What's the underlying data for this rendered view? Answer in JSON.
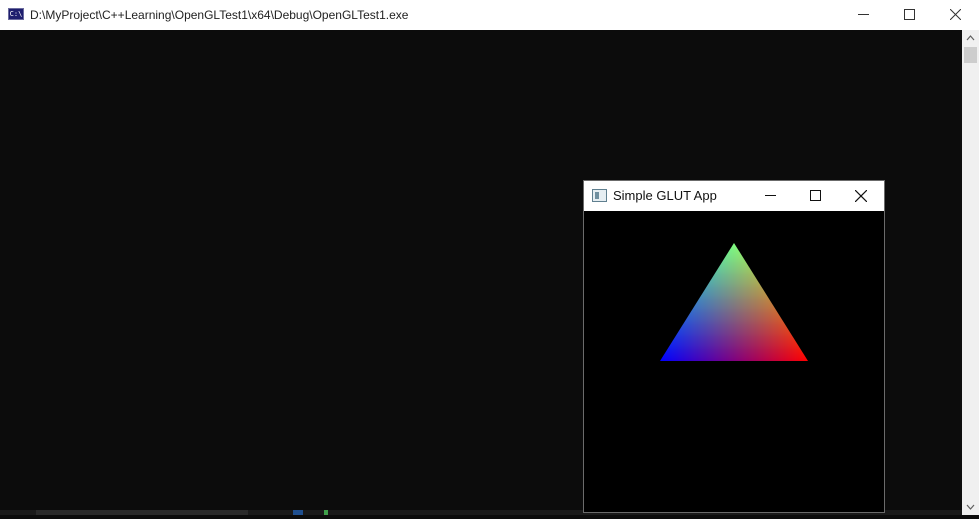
{
  "console": {
    "title": "D:\\MyProject\\C++Learning\\OpenGLTest1\\x64\\Debug\\OpenGLTest1.exe",
    "icon_text": "C:\\",
    "icon": "console-app-icon"
  },
  "glut_window": {
    "title": "Simple GLUT App",
    "icon": "app-window-icon",
    "scene": {
      "shape": "triangle",
      "vertex_colors": {
        "top": "#00ff00",
        "bottom_left": "#0000ff",
        "bottom_right": "#ff0000"
      },
      "background": "#000000"
    }
  },
  "window_controls": [
    "minimize-icon",
    "maximize-icon",
    "close-icon"
  ]
}
